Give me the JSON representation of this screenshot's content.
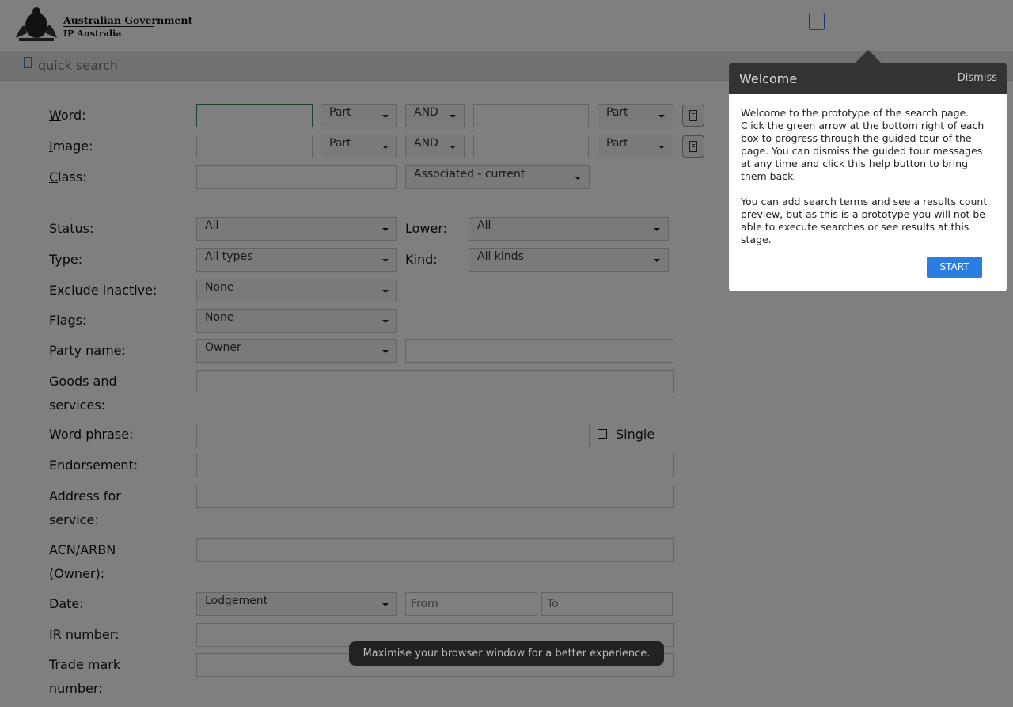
{
  "header": {
    "gov_line1": "Australian Government",
    "gov_line2": "IP Australia"
  },
  "quick_search": {
    "placeholder": "quick search"
  },
  "form": {
    "word": {
      "label_first": "W",
      "label_rest": "ord:",
      "part_left": "Part",
      "operator": "AND",
      "part_right": "Part"
    },
    "image": {
      "label_first": "I",
      "label_rest": "mage:",
      "part_left": "Part",
      "operator": "AND",
      "part_right": "Part"
    },
    "class": {
      "label_first": "C",
      "label_rest": "lass:",
      "scope": "Associated - current"
    },
    "status": {
      "label": "Status:",
      "value": "All"
    },
    "lower": {
      "label": "Lower:",
      "value": "All"
    },
    "type": {
      "label": "Type:",
      "value": "All types"
    },
    "kind": {
      "label": "Kind:",
      "value": "All kinds"
    },
    "exclude_inactive": {
      "label": "Exclude inactive:",
      "value": "None"
    },
    "flags": {
      "label": "Flags:",
      "value": "None"
    },
    "party_name": {
      "label": "Party name:",
      "value": "Owner"
    },
    "goods_services": {
      "label_line1": "Goods and",
      "label_line2": "services:"
    },
    "word_phrase": {
      "label": "Word phrase:",
      "single_label": "Single"
    },
    "endorsement": {
      "label": "Endorsement:"
    },
    "address_service": {
      "label_line1": "Address for",
      "label_line2": "service:"
    },
    "acn_arbn": {
      "label_line1": "ACN/ARBN",
      "label_line2": "(Owner):"
    },
    "date": {
      "label": "Date:",
      "value": "Lodgement",
      "from_placeholder": "From",
      "to_placeholder": "To"
    },
    "ir_number": {
      "label": "IR number:"
    },
    "trade_mark_number": {
      "label_line1": "Trade mark",
      "label_line2_first": "n",
      "label_line2_rest": "umber:"
    }
  },
  "popup": {
    "title": "Welcome",
    "dismiss": "Dismiss",
    "para1": "Welcome to the prototype of the search page. Click the green arrow at the bottom right of each box to progress through the guided tour of the page. You can dismiss the guided tour messages at any time and click this help button to bring them back.",
    "para2": "You can add search terms and see a results count preview, but as this is a prototype you will not be able to execute searches or see results at this stage.",
    "start": "START"
  },
  "toast": "Maximise your browser window for a better experience.",
  "colors": {
    "accent": "#2a7de1",
    "popup_header": "#333333",
    "overlay": "rgba(0,0,0,0.5)"
  }
}
